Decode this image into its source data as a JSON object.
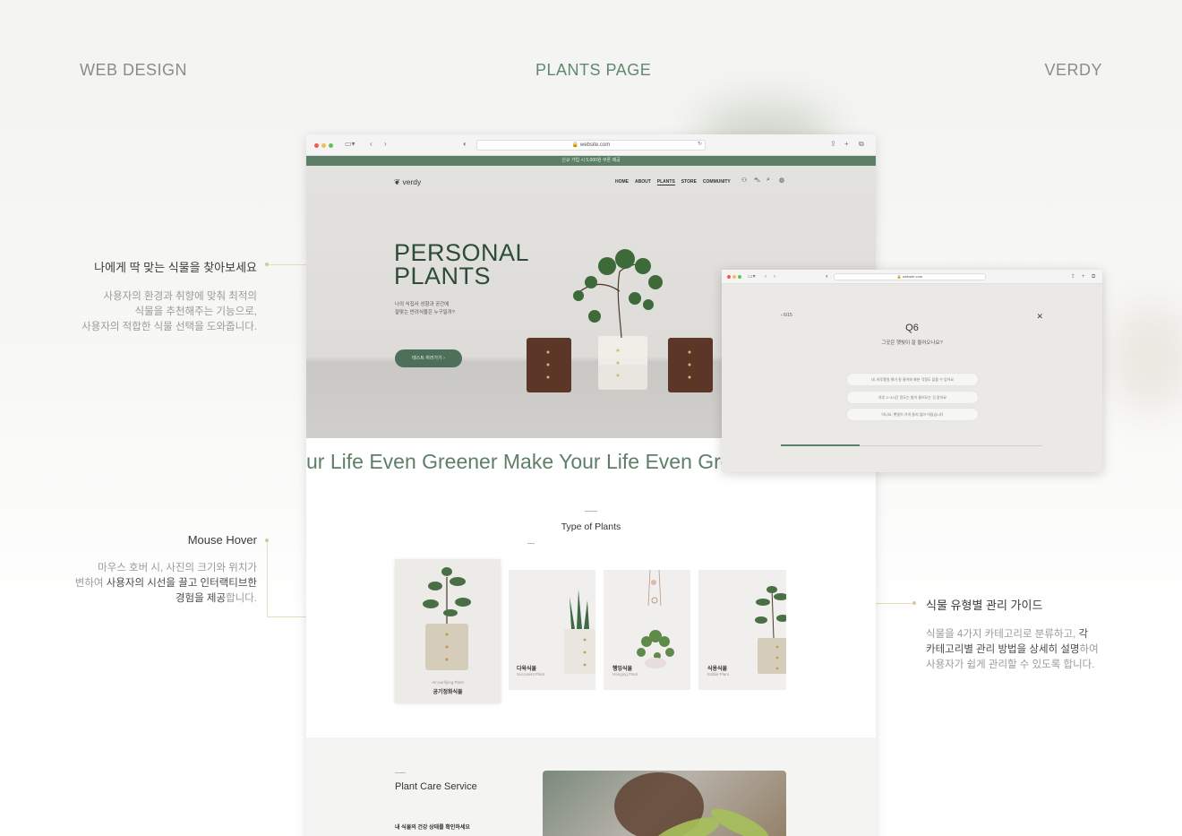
{
  "header": {
    "left": "WEB DESIGN",
    "center": "PLANTS PAGE",
    "right": "VERDY"
  },
  "notes": {
    "recommend": {
      "title": "나에게 딱 맞는 식물을 찾아보세요",
      "line1": "사용자의 환경과 취향에 맞춰 최적의",
      "line2": "식물을 추천해주는 기능으로,",
      "line3": "사용자의 적합한 식물 선택을 도와줍니다."
    },
    "hover": {
      "title": "Mouse Hover",
      "line1": "마우스 호버 시, 사진의 크기와 위치가",
      "line2_a": "변하여 ",
      "line2_b": "사용자의 시선을 끌고 인터랙티브한",
      "line3_a": "경험을 제공",
      "line3_b": "합니다."
    },
    "guide": {
      "title": "식물 유형별 관리 가이드",
      "line1_a": "식물을 4가지 카테고리로 분류하고, ",
      "line1_b": "각",
      "line2_a": "카테고리별 관리 방법을 상세히 설명",
      "line2_b": "하여",
      "line3": "사용자가 쉽게 관리할 수 있도록 합니다."
    }
  },
  "browser": {
    "url": "🔒 website.com",
    "announce": "신규 가입 시 5,000원 쿠폰 제공",
    "logo": "verdy",
    "nav": [
      "HOME",
      "ABOUT",
      "PLANTS",
      "STORE",
      "COMMUNITY"
    ],
    "hero": {
      "title_line1": "PERSONAL",
      "title_line2": "PLANTS",
      "sub_line1": "나의 식집사 성향과 공간에",
      "sub_line2": "잘맞는 반려식물은 누구일까?",
      "button": "테스트 하러가기  ›"
    },
    "marquee": "ur Life Even Greener   Make Your Life Even Greener",
    "types": {
      "title": "Type of Plants",
      "cards": [
        {
          "en": "Air-purifying Plant",
          "ko": "공기정화식물"
        },
        {
          "en": "Succulent Plant",
          "ko": "다육식물"
        },
        {
          "en": "Hanging Plant",
          "ko": "행잉식물"
        },
        {
          "en": "Edible Plant",
          "ko": "식용식물"
        }
      ]
    },
    "care": {
      "title": "Plant Care Service",
      "sub": "내 식물의 건강 상태를 확인하세요"
    }
  },
  "popup": {
    "url": "🔒 website.com",
    "back": "‹ 6/15",
    "close": "✕",
    "question_num": "Q6",
    "question": "그곳은 햇빛이 잘 들어오나요?",
    "options": [
      "네, 하루종일 해가 잘 들어와 화분 걱정도 없을 수 있어요",
      "하루 2~3시간 정도는 빛이 들어오는 것 같아요",
      "아니요, 햇빛이 거의 들지 않아 어둡습니다"
    ],
    "progress": 0.3
  }
}
